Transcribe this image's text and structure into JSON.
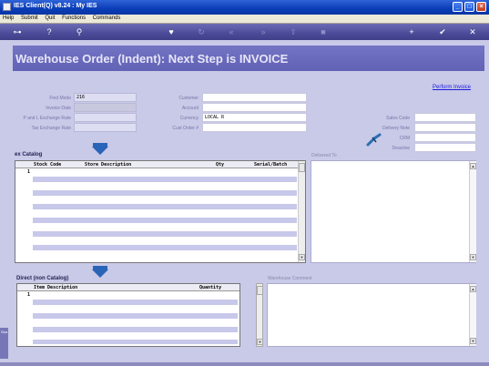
{
  "window": {
    "title": "IES Client(Q) v8.24 : My IES",
    "min_label": "_",
    "max_label": "□",
    "close_label": "×"
  },
  "menu": [
    "Help",
    "Submit",
    "Quit",
    "Functions",
    "Commands"
  ],
  "toolbar": {
    "icons": [
      "key-icon",
      "help-icon",
      "search-icon",
      "heart-icon",
      "history-icon",
      "rewind-icon",
      "fast-forward-icon",
      "upload-icon",
      "stop-icon",
      "add-icon",
      "confirm-icon",
      "close-icon"
    ],
    "glyphs": [
      "⊶",
      "?",
      "⚲",
      "♥",
      "↻",
      "«",
      "»",
      "⇧",
      "■",
      "+",
      "✔",
      "✕"
    ]
  },
  "header": {
    "title": "Warehouse Order (Indent): Next Step is INVOICE"
  },
  "perform_invoice_link": "Perform Invoice",
  "left_fields": [
    {
      "label": "Find Mode",
      "value": "216"
    },
    {
      "label": "Invoice Date",
      "value": ""
    },
    {
      "label": "P and L Exchange Rate",
      "value": ""
    },
    {
      "label": "Tax Exchange Rate",
      "value": ""
    }
  ],
  "mid_fields": [
    {
      "label": "Customer",
      "value": ""
    },
    {
      "label": "Account",
      "value": ""
    },
    {
      "label": "Currency",
      "value": "LOCAL R"
    },
    {
      "label": "Cust Order #",
      "value": ""
    }
  ],
  "right_fields": [
    {
      "label": "Sales Code",
      "value": ""
    },
    {
      "label": "Delivery Note",
      "value": ""
    },
    {
      "label": "CRM",
      "value": ""
    },
    {
      "label": "Deactive",
      "value": ""
    }
  ],
  "catalog": {
    "title": "ex Catalog",
    "columns": [
      "Stock Code",
      "Store Description",
      "Qty",
      "Serial/Batch"
    ],
    "first_row_number": "1"
  },
  "delivered_to": {
    "label": "Delivered To"
  },
  "direct": {
    "title": "Direct (non Catalog)",
    "columns": [
      "Item Description",
      "Quantity"
    ],
    "first_row_number": "1"
  },
  "warehouse_comment": {
    "label": "Warehouse Comment"
  },
  "side_tab_label": "Sea"
}
